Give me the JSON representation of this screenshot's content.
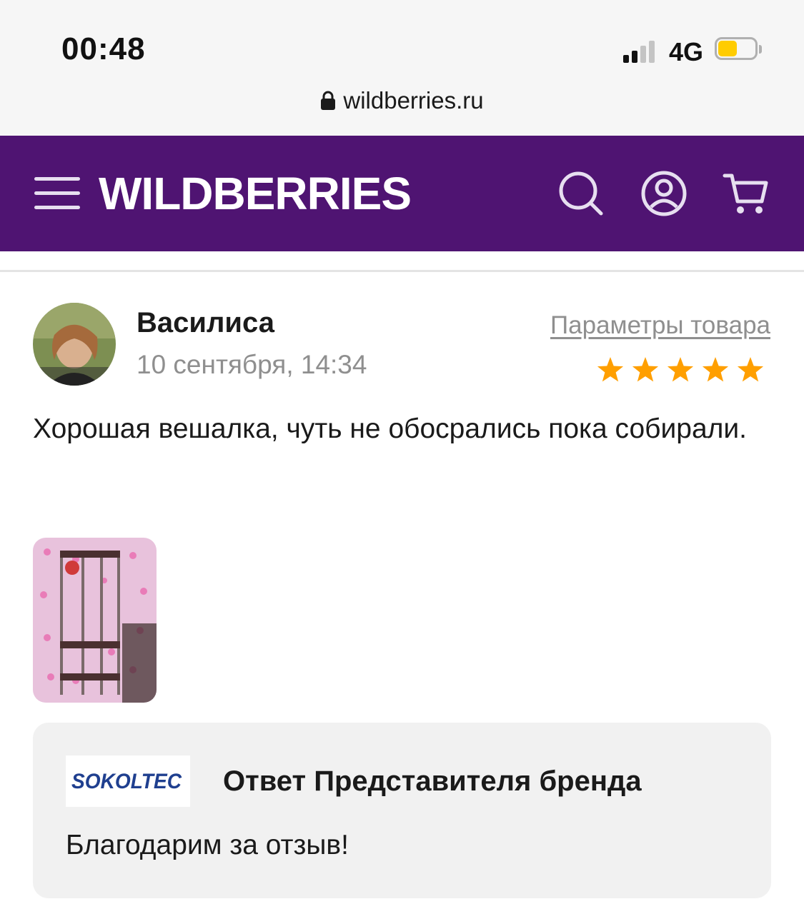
{
  "status_bar": {
    "time": "00:48",
    "network": "4G",
    "battery_level": 0.55,
    "battery_color": "#ffcc00"
  },
  "browser": {
    "url": "wildberries.ru",
    "lock_icon": "lock-icon"
  },
  "header": {
    "logo": "WILDBERRIES",
    "background": "#4f1472",
    "icons": [
      "menu-icon",
      "search-icon",
      "user-icon",
      "cart-icon"
    ]
  },
  "review": {
    "author": "Василиса",
    "date": "10 сентября, 14:34",
    "product_params_link": "Параметры товара",
    "rating": 5,
    "rating_max": 5,
    "star_color": "#ff9f00",
    "text": "Хорошая вешалка, чуть не обосрались пока собирали.",
    "photos_count": 1
  },
  "brand_answer": {
    "brand_logo_text": "SOKOLTEC",
    "title": "Ответ Представителя бренда",
    "text": "Благодарим за отзыв!"
  }
}
